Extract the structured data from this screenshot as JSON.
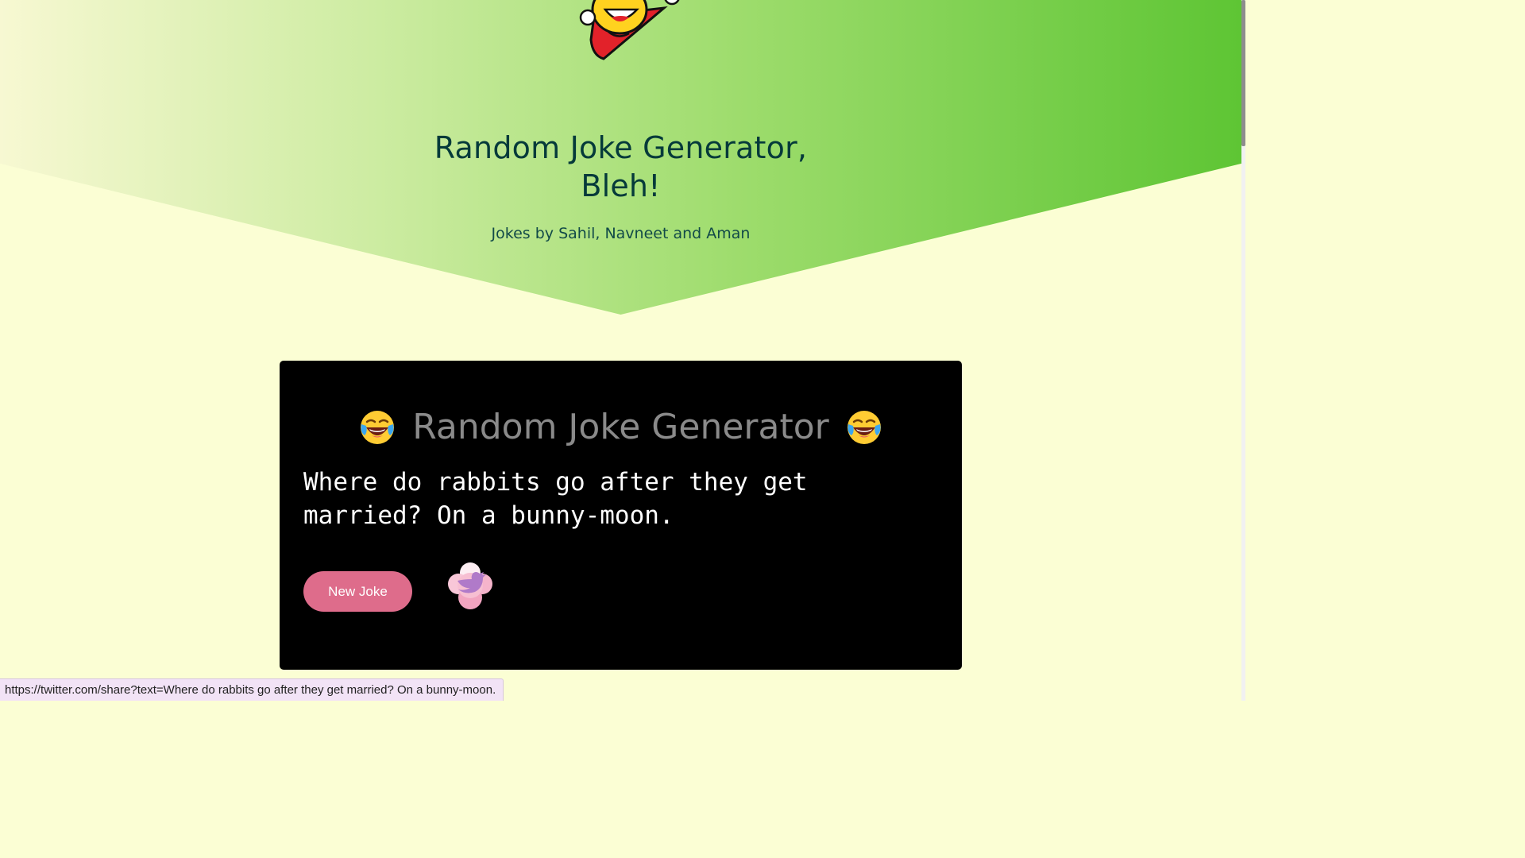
{
  "hero": {
    "title": "Random Joke Generator, Bleh!",
    "subtitle": "Jokes by Sahil, Navneet and Aman"
  },
  "card": {
    "title": "Random Joke Generator",
    "emoji_left": "face-with-tears-of-joy-icon",
    "emoji_right": "face-with-tears-of-joy-icon",
    "joke": "Where do rabbits go after they get married? On a bunny-moon.",
    "new_joke_label": "New Joke",
    "tweet_icon": "twitter-bird-icon"
  },
  "status_bar": {
    "url": "https://twitter.com/share?text=Where do rabbits go after they get married? On a bunny-moon."
  },
  "colors": {
    "background": "#fbfed4",
    "hero_gradient_start": "#f7f8d2",
    "hero_gradient_end": "#5ec534",
    "card": "#000000",
    "button": "#de6c8b",
    "heading": "#053a3a"
  }
}
